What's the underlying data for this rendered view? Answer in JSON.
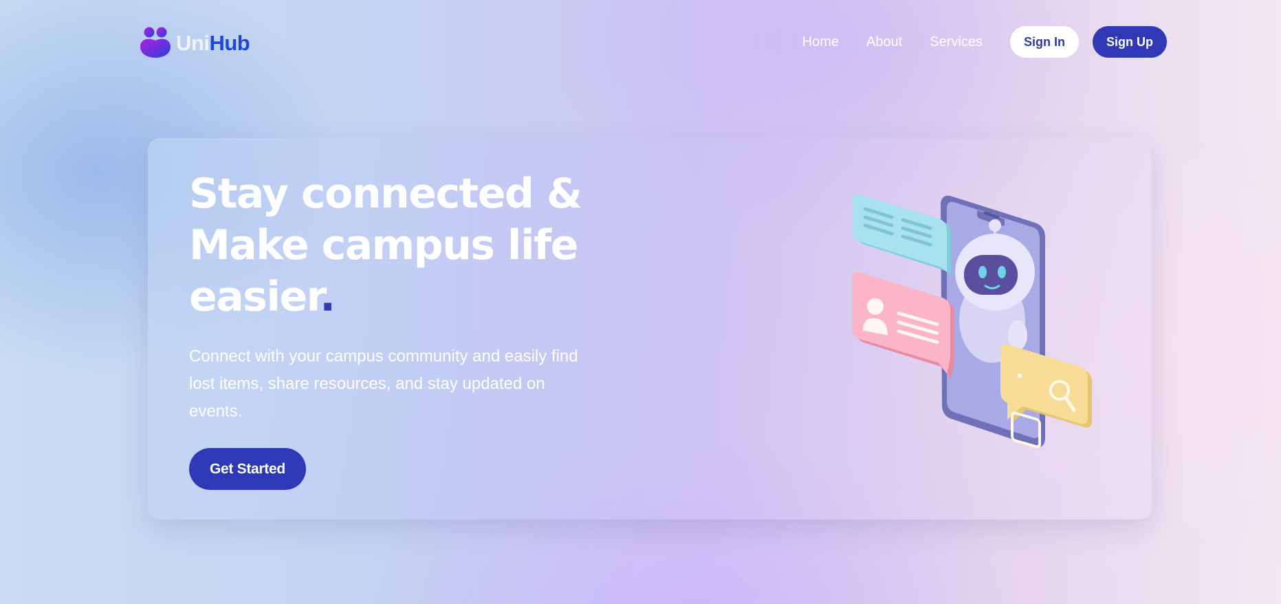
{
  "brand": {
    "name_part1": "Uni",
    "name_part2": "Hub",
    "logo_icon": "people-icon"
  },
  "nav": {
    "links": [
      "Home",
      "About",
      "Services"
    ],
    "signin_label": "Sign In",
    "signup_label": "Sign Up"
  },
  "hero": {
    "title_lines": [
      "Stay connected &",
      "Make campus life",
      "easier"
    ],
    "title_dot": ".",
    "description": "Connect with your campus community and easily find lost items, share resources, and stay updated on events.",
    "cta_label": "Get Started",
    "illustration_icon": "chatbot-phone-illustration"
  },
  "colors": {
    "accent": "#2f39b8",
    "brand_blue": "#1f46d8",
    "chat_bubble_cyan": "#a8e2ef",
    "chat_bubble_pink": "#fbb4c8",
    "chat_bubble_yellow": "#f7dc98",
    "phone_purple": "#7c7dc5"
  }
}
